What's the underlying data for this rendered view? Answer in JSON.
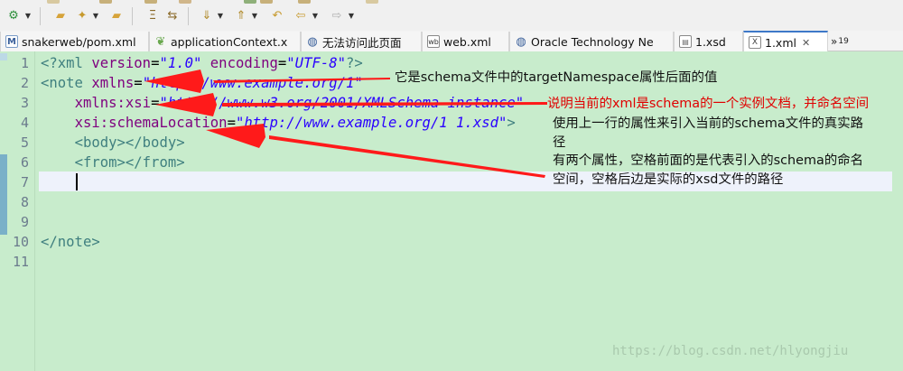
{
  "toolbar": {
    "buttons": [
      {
        "name": "run-config-icon",
        "glyph": "⚙",
        "color": "#2b8f3a"
      },
      {
        "name": "open-folder-icon",
        "glyph": "📂",
        "color": "#d6a33a"
      },
      {
        "name": "debug-icon",
        "glyph": "✦",
        "color": "#c79a2e"
      },
      {
        "name": "open-file-icon",
        "glyph": "📂",
        "color": "#d6a33a"
      },
      {
        "name": "align-icon",
        "glyph": "Ξ",
        "color": "#8a6a2a"
      },
      {
        "name": "toggle-icon",
        "glyph": "⇆",
        "color": "#8a6a2a"
      },
      {
        "name": "next-annotation-icon",
        "glyph": "⇓",
        "color": "#b08a2a"
      },
      {
        "name": "previous-annotation-icon",
        "glyph": "⇑",
        "color": "#b08a2a"
      },
      {
        "name": "last-edit-icon",
        "glyph": "↶",
        "color": "#c79a2e"
      },
      {
        "name": "back-icon",
        "glyph": "⇦",
        "color": "#c79a2e"
      },
      {
        "name": "forward-icon",
        "glyph": "⇨",
        "color": "#b0b0b0"
      }
    ]
  },
  "tabs": [
    {
      "label": "snakerweb/pom.xml",
      "icon": "maven-icon",
      "active": false
    },
    {
      "label": "applicationContext.x",
      "icon": "spring-leaf-icon",
      "active": false
    },
    {
      "label": "无法访问此页面",
      "icon": "browser-globe-icon",
      "active": false
    },
    {
      "label": "web.xml",
      "icon": "web-xml-icon",
      "active": false
    },
    {
      "label": "Oracle Technology Ne",
      "icon": "browser-globe-icon",
      "active": false
    },
    {
      "label": "1.xsd",
      "icon": "xsd-file-icon",
      "active": false
    },
    {
      "label": "1.xml",
      "icon": "xml-file-icon",
      "active": true,
      "close": "✕"
    }
  ],
  "tab_overflow": {
    "symbol": "»",
    "count": "19"
  },
  "editor": {
    "line_numbers": [
      "1",
      "2",
      "3",
      "4",
      "5",
      "6",
      "7",
      "8",
      "9",
      "10",
      "11"
    ],
    "lines": [
      [
        {
          "t": "<?",
          "c": "c-tag"
        },
        {
          "t": "xml ",
          "c": "c-tag"
        },
        {
          "t": "version",
          "c": "c-attr"
        },
        {
          "t": "=",
          "c": "c-txt"
        },
        {
          "t": "\"1.0\"",
          "c": "c-val"
        },
        {
          "t": " ",
          "c": "c-txt"
        },
        {
          "t": "encoding",
          "c": "c-attr"
        },
        {
          "t": "=",
          "c": "c-txt"
        },
        {
          "t": "\"UTF-8\"",
          "c": "c-val"
        },
        {
          "t": "?>",
          "c": "c-tag"
        }
      ],
      [
        {
          "t": "<note ",
          "c": "c-tag"
        },
        {
          "t": "xmlns",
          "c": "c-attr"
        },
        {
          "t": "=",
          "c": "c-txt"
        },
        {
          "t": "\"http://www.example.org/1\"",
          "c": "c-val"
        }
      ],
      [
        {
          "t": "    ",
          "c": "c-txt"
        },
        {
          "t": "xmlns:xsi",
          "c": "c-attr"
        },
        {
          "t": "=",
          "c": "c-txt"
        },
        {
          "t": "\"http://www.w3.org/2001/XMLSchema-instance\"",
          "c": "c-val"
        }
      ],
      [
        {
          "t": "    ",
          "c": "c-txt"
        },
        {
          "t": "xsi:schemaLocation",
          "c": "c-attr"
        },
        {
          "t": "=",
          "c": "c-txt"
        },
        {
          "t": "\"http://www.example.org/1 1.xsd\"",
          "c": "c-val"
        },
        {
          "t": ">",
          "c": "c-tag"
        }
      ],
      [
        {
          "t": "    ",
          "c": "c-txt"
        },
        {
          "t": "<body></body>",
          "c": "c-tag"
        }
      ],
      [
        {
          "t": "    ",
          "c": "c-txt"
        },
        {
          "t": "<from></from>",
          "c": "c-tag"
        }
      ],
      [],
      [],
      [],
      [
        {
          "t": "</note>",
          "c": "c-tag"
        }
      ],
      []
    ]
  },
  "annotations": {
    "xmlns_note": "它是schema文件中的targetNamespace属性后面的值",
    "xsi_note": "说明当前的xml是schema的一个实例文档，并命名空间",
    "schema_location_note_1": "使用上一行的属性来引入当前的schema文件的真实路",
    "schema_location_note_2": "径",
    "schema_location_note_3": "有两个属性，空格前面的是代表引入的schema的命名",
    "schema_location_note_4": "空间，空格后边是实际的xsd文件的路径",
    "arrow_color": "#ff1a1a"
  },
  "watermark": "https://blog.csdn.net/hlyongjiu"
}
